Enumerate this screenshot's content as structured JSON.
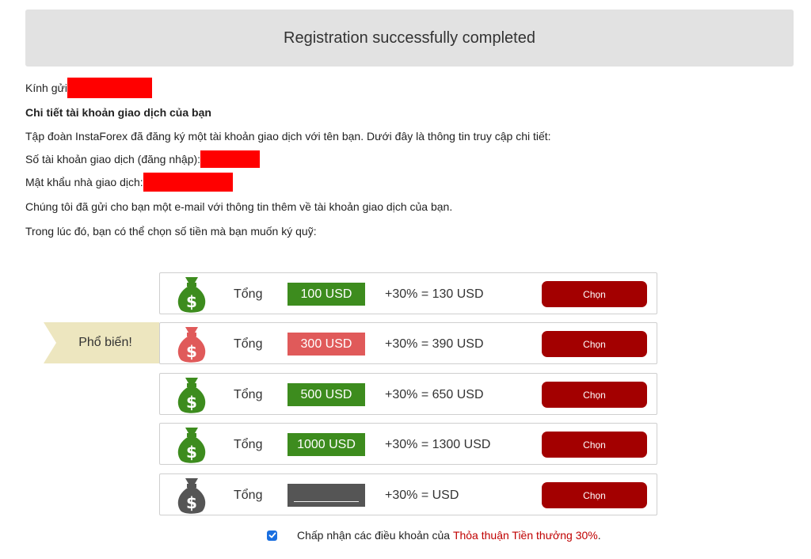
{
  "banner": {
    "title": "Registration successfully completed"
  },
  "info": {
    "greeting": "Kính gửi",
    "heading": "Chi tiết tài khoản giao dịch của bạn",
    "intro": "Tập đoàn InstaForex đã đăng ký một tài khoản giao dịch với tên bạn. Dưới đây là thông tin truy cập chi tiết:",
    "account_label": "Số tài khoản giao dịch (đăng nhập):",
    "password_label": "Mật khẩu nhà giao dịch:",
    "email_note": "Chúng tôi đã gửi cho bạn một e-mail với thông tin thêm về tài khoản giao dịch của bạn.",
    "deposit_prompt": "Trong lúc đó, bạn có thể chọn số tiền mà bạn muốn ký quỹ:"
  },
  "popular_label": "Phổ biến!",
  "options": [
    {
      "total_label": "Tổng",
      "amount": "100 USD",
      "bonus": "+30% = 130 USD",
      "button": "Chọn",
      "color": "#3d8c1e"
    },
    {
      "total_label": "Tổng",
      "amount": "300 USD",
      "bonus": "+30% = 390 USD",
      "button": "Chọn",
      "color": "#e05a5a"
    },
    {
      "total_label": "Tổng",
      "amount": "500 USD",
      "bonus": "+30% = 650 USD",
      "button": "Chọn",
      "color": "#3d8c1e"
    },
    {
      "total_label": "Tổng",
      "amount": "1000 USD",
      "bonus": "+30% = 1300 USD",
      "button": "Chọn",
      "color": "#3d8c1e"
    },
    {
      "total_label": "Tổng",
      "amount": "",
      "bonus": "+30% = USD",
      "button": "Chọn",
      "color": "#555555"
    }
  ],
  "agreement": {
    "checked": true,
    "text": "Chấp nhận các điều khoản của",
    "link": "Thỏa thuận Tiền thưởng 30%",
    "end": "."
  }
}
